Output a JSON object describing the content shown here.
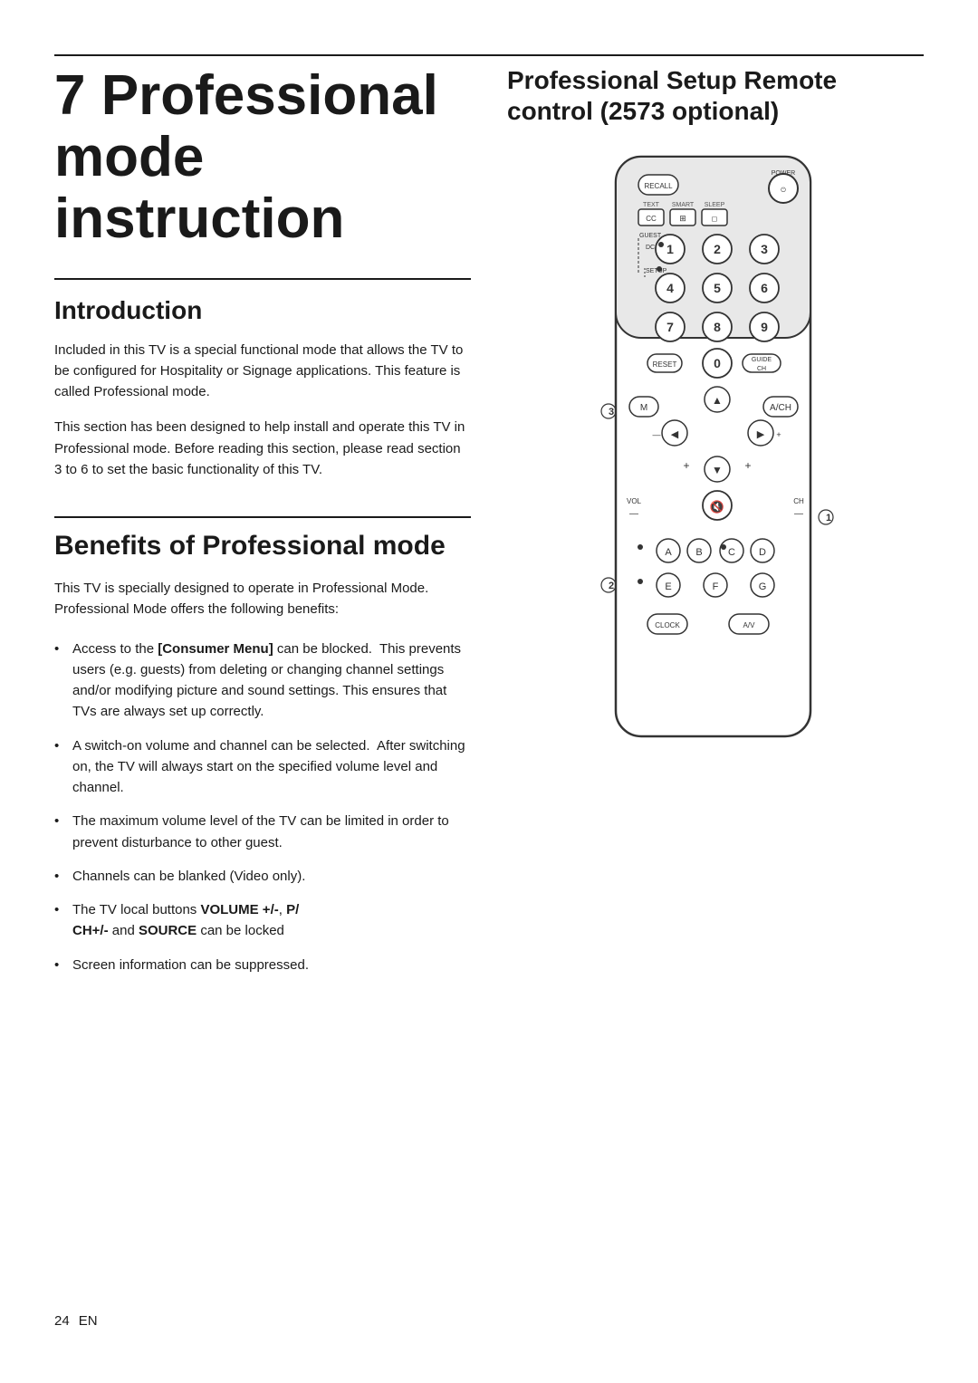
{
  "page": {
    "chapter_number": "7",
    "chapter_title": "Professional\nmode\ninstruction",
    "top_rule": true
  },
  "introduction": {
    "heading": "Introduction",
    "paragraph1": "Included in this TV is a special functional mode that allows the TV to be configured for Hospitality or Signage applications. This feature is called Professional mode.",
    "paragraph2": "This section has been designed to help install and operate this TV in Professional mode. Before reading this section, please read section 3 to 6 to set the basic functionality of this TV."
  },
  "benefits": {
    "heading": "Benefits of Professional mode",
    "intro": "This TV is specially designed to operate in Professional Mode. Professional Mode offers the following benefits:",
    "items": [
      "Access to the [Consumer Menu] can be blocked.  This prevents users (e.g. guests) from deleting or changing channel settings and/or modifying picture and sound settings. This ensures that TVs are always set up correctly.",
      "A switch-on volume and channel can be selected.  After switching on, the TV will always start on the specified volume level and channel.",
      "The maximum volume level of the TV can be limited in order to prevent disturbance to other guest.",
      "Channels can be blanked (Video only).",
      "The TV local buttons VOLUME +/-, P/CH+/- and SOURCE can be locked",
      "Screen information can be suppressed."
    ],
    "item_bold": [
      {
        "text": "[Consumer Menu]",
        "index": 0
      },
      {
        "text": "VOLUME +/-, P/CH+/-",
        "index": 4
      },
      {
        "text": "SOURCE",
        "index": 4
      }
    ]
  },
  "right_heading": {
    "line1": "Professional Setup Remote",
    "line2": "control (2573 optional)"
  },
  "remote": {
    "labels": {
      "power": "POWER",
      "recall": "RECALL",
      "text": "TEXT",
      "smart": "SMART",
      "sleep": "SLEEP",
      "cc": "CC",
      "guest": "GUEST",
      "dcm": "DCM",
      "setup": "SETUP",
      "reset": "RESET",
      "guide": "GUIDE",
      "ch": "CH",
      "vol": "VOL",
      "clock": "CLOCK",
      "av": "A/V",
      "m_label": "M",
      "ach_label": "A/CH",
      "a_btn": "A",
      "b_btn": "B",
      "c_btn": "C",
      "d_btn": "D",
      "e_btn": "E",
      "f_btn": "F",
      "g_btn": "G",
      "annotation_1": "1",
      "annotation_2": "2",
      "annotation_3": "3"
    }
  },
  "footer": {
    "page_number": "24",
    "language": "EN"
  }
}
